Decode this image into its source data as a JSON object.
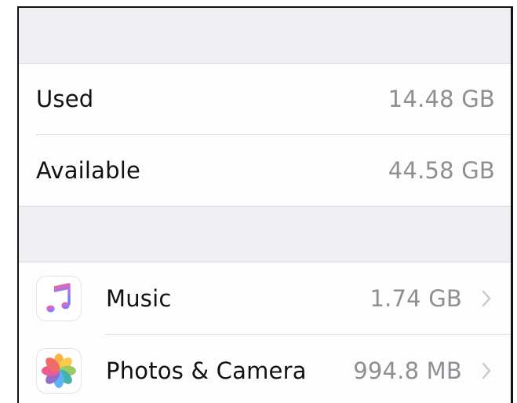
{
  "storage": {
    "used_label": "Used",
    "used_value": "14.48 GB",
    "available_label": "Available",
    "available_value": "44.58 GB"
  },
  "apps": [
    {
      "name": "Music",
      "size": "1.74 GB",
      "icon": "music-note-icon"
    },
    {
      "name": "Photos & Camera",
      "size": "994.8 MB",
      "icon": "photos-flower-icon"
    }
  ],
  "colors": {
    "background_gray": "#efeff4",
    "value_gray": "#8e8e93",
    "chevron_gray": "#c7c7cc"
  }
}
